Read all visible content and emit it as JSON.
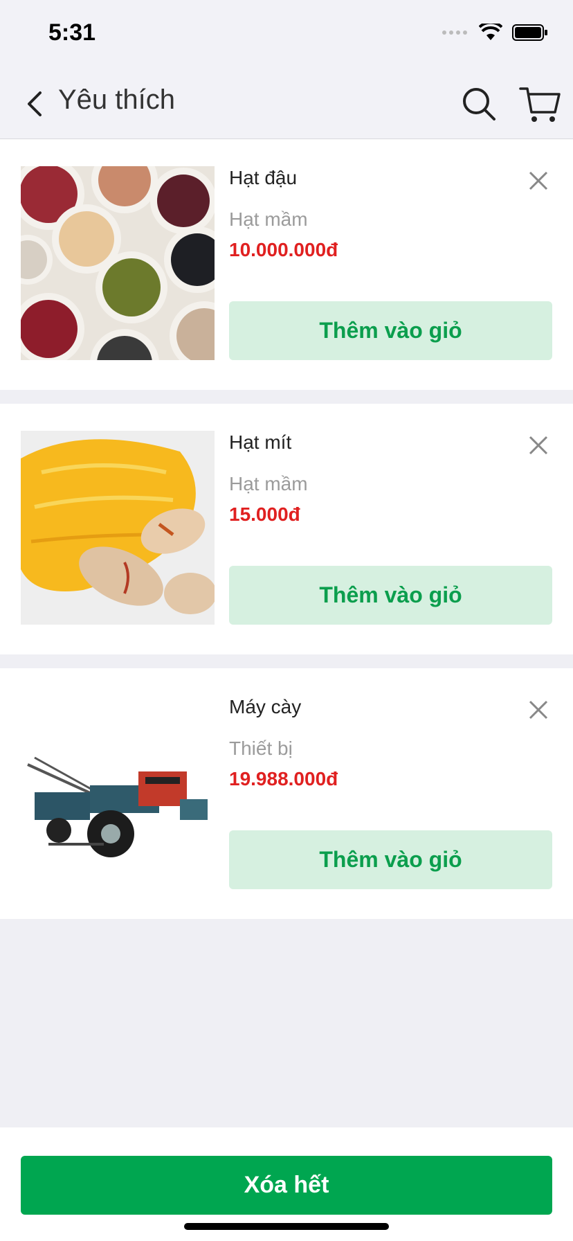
{
  "status": {
    "time": "5:31"
  },
  "nav": {
    "title": "Yêu thích"
  },
  "items": [
    {
      "name": "Hạt đậu",
      "category": "Hạt mầm",
      "price": "10.000.000đ",
      "add_label": "Thêm vào giỏ"
    },
    {
      "name": "Hạt mít",
      "category": "Hạt mầm",
      "price": "15.000đ",
      "add_label": "Thêm vào giỏ"
    },
    {
      "name": "Máy cày",
      "category": "Thiết bị",
      "price": "19.988.000đ",
      "add_label": "Thêm vào giỏ"
    }
  ],
  "footer": {
    "clear_label": "Xóa hết"
  },
  "colors": {
    "accent": "#00a650",
    "price": "#e02020",
    "add_bg": "#d6f0e0"
  },
  "icons": [
    "back-icon",
    "search-icon",
    "cart-icon",
    "close-icon",
    "wifi-icon",
    "battery-icon",
    "signal-icon"
  ]
}
